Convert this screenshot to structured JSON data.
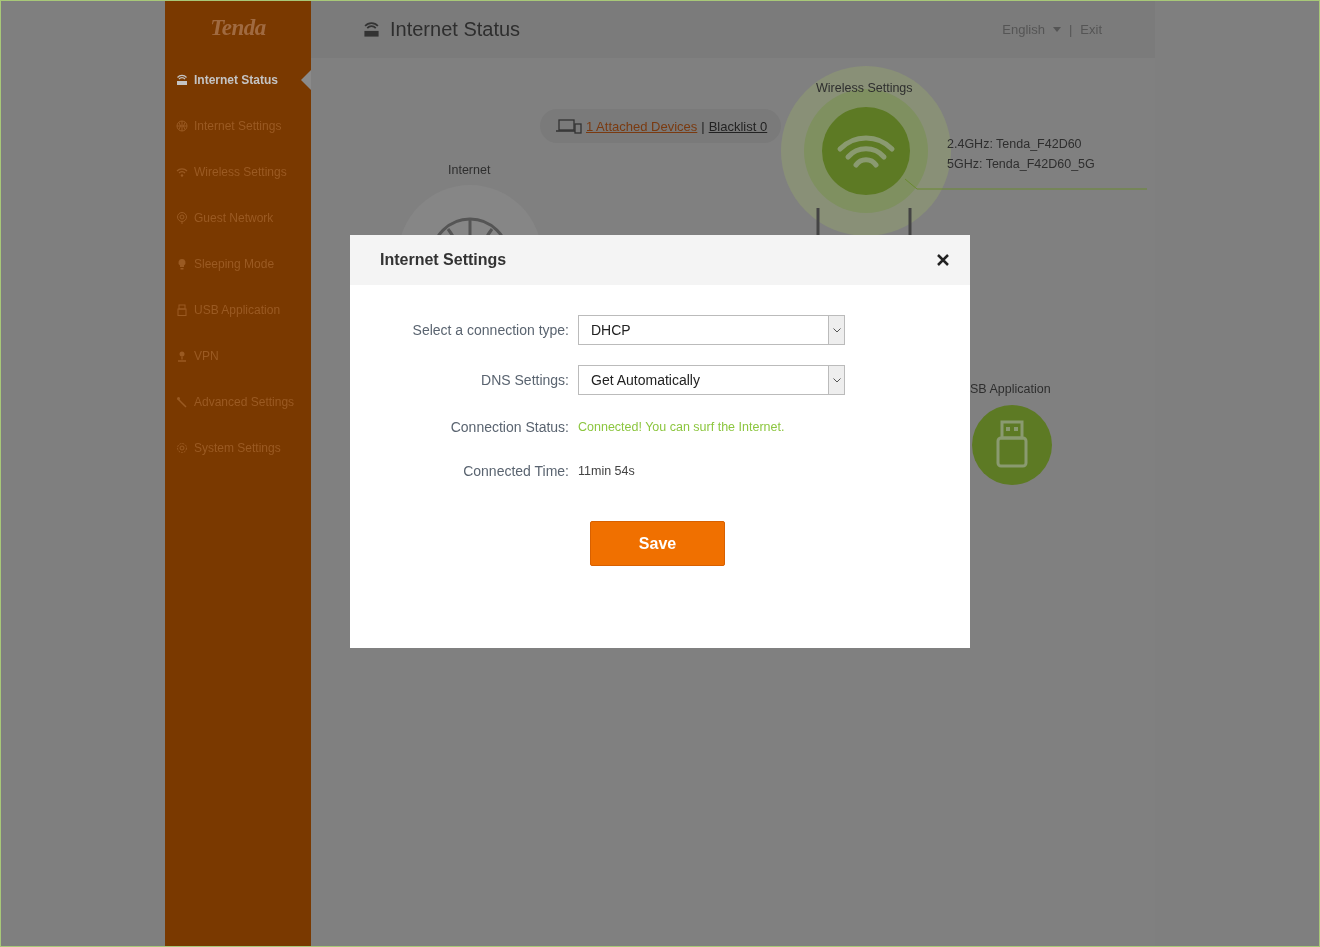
{
  "sidebar": {
    "logo": "Tenda",
    "items": [
      {
        "label": "Internet Status",
        "selected": true
      },
      {
        "label": "Internet Settings",
        "selected": false
      },
      {
        "label": "Wireless Settings",
        "selected": false
      },
      {
        "label": "Guest Network",
        "selected": false
      },
      {
        "label": "Sleeping Mode",
        "selected": false
      },
      {
        "label": "USB Application",
        "selected": false
      },
      {
        "label": "VPN",
        "selected": false
      },
      {
        "label": "Advanced Settings",
        "selected": false
      },
      {
        "label": "System Settings",
        "selected": false
      }
    ]
  },
  "header": {
    "title": "Internet Status",
    "language": "English",
    "separator": "|",
    "exit": "Exit"
  },
  "diagram": {
    "internet_label": "Internet",
    "devices_link": "1 Attached Devices ",
    "devices_separator": "|",
    "blacklist_link": "Blacklist 0",
    "wireless_label": "Wireless Settings",
    "ssids": [
      "2.4GHz: Tenda_F42D60",
      "5GHz: Tenda_F42D60_5G"
    ],
    "usb_label": "SB Application"
  },
  "dialog": {
    "title": "Internet Settings",
    "fields": [
      {
        "kind": "select",
        "label": "Select a connection type:",
        "value": "DHCP"
      },
      {
        "kind": "select",
        "label": "DNS Settings:",
        "value": "Get Automatically"
      },
      {
        "kind": "status",
        "label": "Connection Status:",
        "value": "Connected! You can surf the Internet."
      },
      {
        "kind": "text",
        "label": "Connected Time:",
        "value": "11min 54s"
      }
    ],
    "save": "Save"
  }
}
